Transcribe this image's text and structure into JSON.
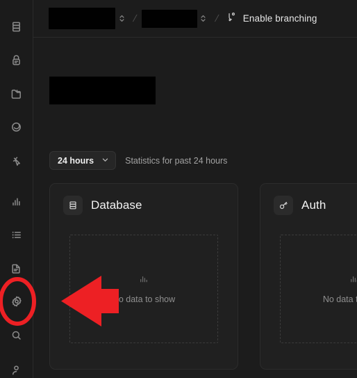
{
  "app": {
    "theme": "dark",
    "background_color": "#1c1c1c",
    "panel_color": "#202020",
    "annotation_color": "#ed2024"
  },
  "sidebar": {
    "items": [
      {
        "icon": "database-icon",
        "label": "Database"
      },
      {
        "icon": "authentication-icon",
        "label": "Authentication"
      },
      {
        "icon": "storage-icon",
        "label": "Storage"
      },
      {
        "icon": "realtime-icon",
        "label": "Realtime"
      },
      {
        "icon": "edge-functions-icon",
        "label": "Edge Functions"
      },
      {
        "icon": "reports-icon",
        "label": "Reports"
      },
      {
        "icon": "logs-icon",
        "label": "Logs"
      },
      {
        "icon": "api-docs-icon",
        "label": "API Docs"
      },
      {
        "icon": "settings-gear-icon",
        "label": "Project Settings"
      },
      {
        "icon": "search-icon",
        "label": "Search"
      },
      {
        "icon": "account-icon",
        "label": "Account"
      }
    ]
  },
  "topbar": {
    "organization": {
      "value": "",
      "redacted": true
    },
    "project": {
      "value": "",
      "redacted": true
    },
    "separator": "/",
    "branching": {
      "label": "Enable branching",
      "icon": "git-branch-icon"
    },
    "selector_icon": "chevron-up-down-icon"
  },
  "main": {
    "page_title": {
      "value": "",
      "redacted": true
    },
    "range": {
      "selected": "24 hours",
      "chevron_icon": "chevron-down-icon",
      "caption": "Statistics for past 24 hours"
    },
    "cards": [
      {
        "title": "Database",
        "icon": "database-icon",
        "empty_state": {
          "icon": "bar-chart-icon",
          "text": "No data to show"
        }
      },
      {
        "title": "Auth",
        "icon": "key-icon",
        "empty_state": {
          "icon": "bar-chart-icon",
          "text": "No data to show"
        }
      }
    ]
  },
  "annotations": {
    "highlight_circle": {
      "shape": "ellipse",
      "target": "settings-gear-icon",
      "color": "#ed2024"
    },
    "pointer_arrow": {
      "shape": "arrow",
      "direction": "left",
      "color": "#ed2024"
    }
  }
}
